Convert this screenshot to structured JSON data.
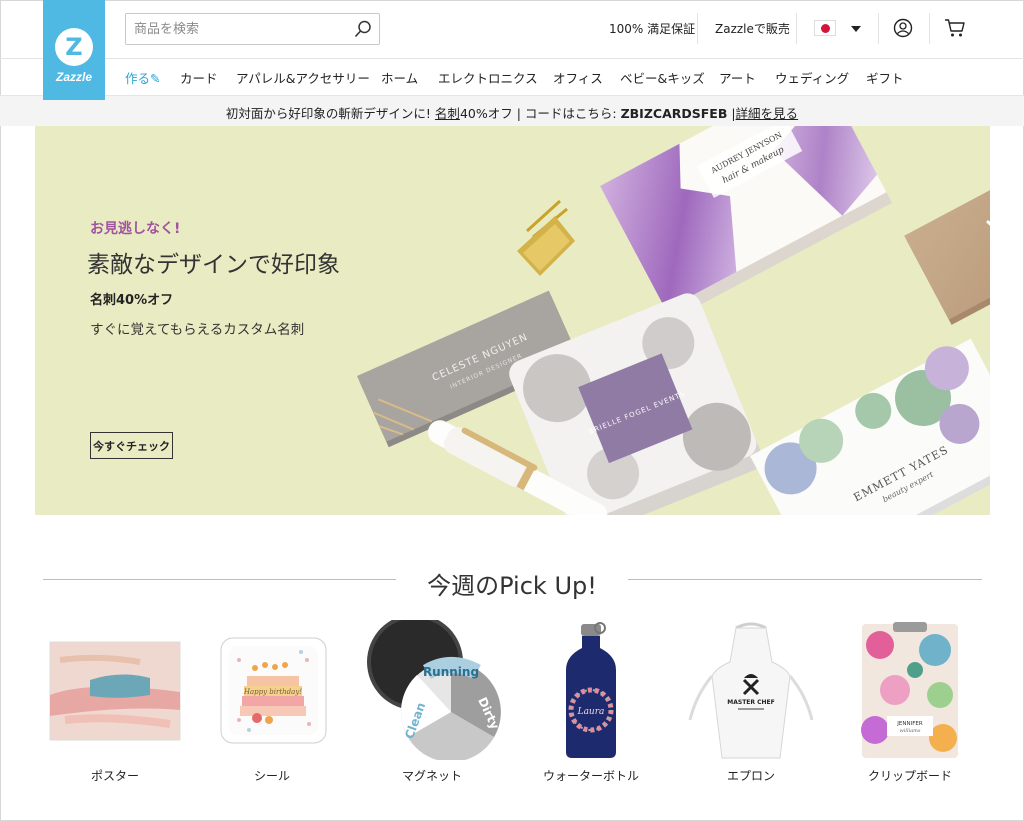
{
  "logo": {
    "brand": "Zazzle",
    "glyph": "Z"
  },
  "search": {
    "placeholder": "商品を検索"
  },
  "header": {
    "guarantee": "100% 満足保証",
    "sell": "Zazzleで販売"
  },
  "nav": {
    "items": [
      {
        "label": "作る✎",
        "accent": true
      },
      {
        "label": "カード"
      },
      {
        "label": "アパレル&アクセサリー"
      },
      {
        "label": "ホーム"
      },
      {
        "label": "エレクトロニクス"
      },
      {
        "label": "オフィス"
      },
      {
        "label": "ベビー&キッズ"
      },
      {
        "label": "アート"
      },
      {
        "label": "ウェディング"
      },
      {
        "label": "ギフト"
      }
    ]
  },
  "promo": {
    "prefix": "初対面から好印象の斬新デザインに! ",
    "link": "名刺",
    "discount": "40%オフ",
    "divider1": " | ",
    "code_label": "コードはこちら: ",
    "code": "ZBIZCARDSFEB",
    "divider2": " |",
    "details": "詳細を見る"
  },
  "hero": {
    "eyebrow": "お見逃しなく!",
    "title": "素敵なデザインで好印象",
    "sub1": "名刺40%オフ",
    "sub2": "すぐに覚えてもらえるカスタム名刺",
    "button": "今すぐチェック",
    "card_texts": {
      "audrey": "AUDREY JENYSON",
      "audrey_sub": "hair & makeup",
      "celeste": "CELESTE NGUYEN",
      "celeste_sub": "INTERIOR DESIGNER",
      "brielle": "BRIELLE FOGEL EVENTS",
      "emmett": "EMMETT YATES",
      "emmett_sub": "beauty expert"
    }
  },
  "pickup": {
    "title": "今週のPick Up!",
    "products": [
      {
        "label": "ポスター"
      },
      {
        "label": "シール",
        "art_text": "Happy birthday!"
      },
      {
        "label": "マグネット",
        "art_words": [
          "Running",
          "Dirty",
          "Clean"
        ]
      },
      {
        "label": "ウォーターボトル",
        "art_text": "Laura"
      },
      {
        "label": "エプロン",
        "art_text": "MASTER CHEF"
      },
      {
        "label": "クリップボード",
        "art_text": "JENNIFER",
        "art_sub": "williams"
      }
    ]
  },
  "colors": {
    "brand": "#4fb9e3",
    "nav_accent": "#2aa4d2",
    "hero_bg": "#e9ecc3",
    "eyebrow": "#a0539f"
  }
}
